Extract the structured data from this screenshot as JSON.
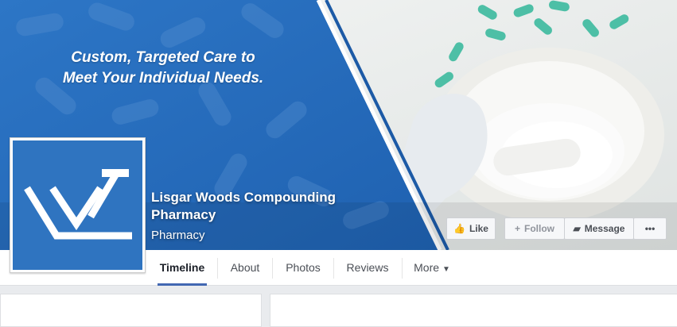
{
  "cover": {
    "tagline_line1": "Custom, Targeted Care to",
    "tagline_line2": "Meet Your Individual Needs.",
    "primary_color": "#2f74c0",
    "secondary_color": "#1c5aa6"
  },
  "page": {
    "name": "Lisgar Woods Compounding Pharmacy",
    "category": "Pharmacy"
  },
  "actions": {
    "like": "Like",
    "follow": "Follow",
    "message": "Message",
    "more": "•••"
  },
  "tabs": [
    {
      "label": "Timeline",
      "active": true
    },
    {
      "label": "About"
    },
    {
      "label": "Photos"
    },
    {
      "label": "Reviews"
    },
    {
      "label": "More"
    }
  ],
  "icons": {
    "like": "thumbs-up-icon",
    "follow": "plus-icon",
    "message": "speech-bubble-icon",
    "more_tab": "caret-down-icon"
  }
}
